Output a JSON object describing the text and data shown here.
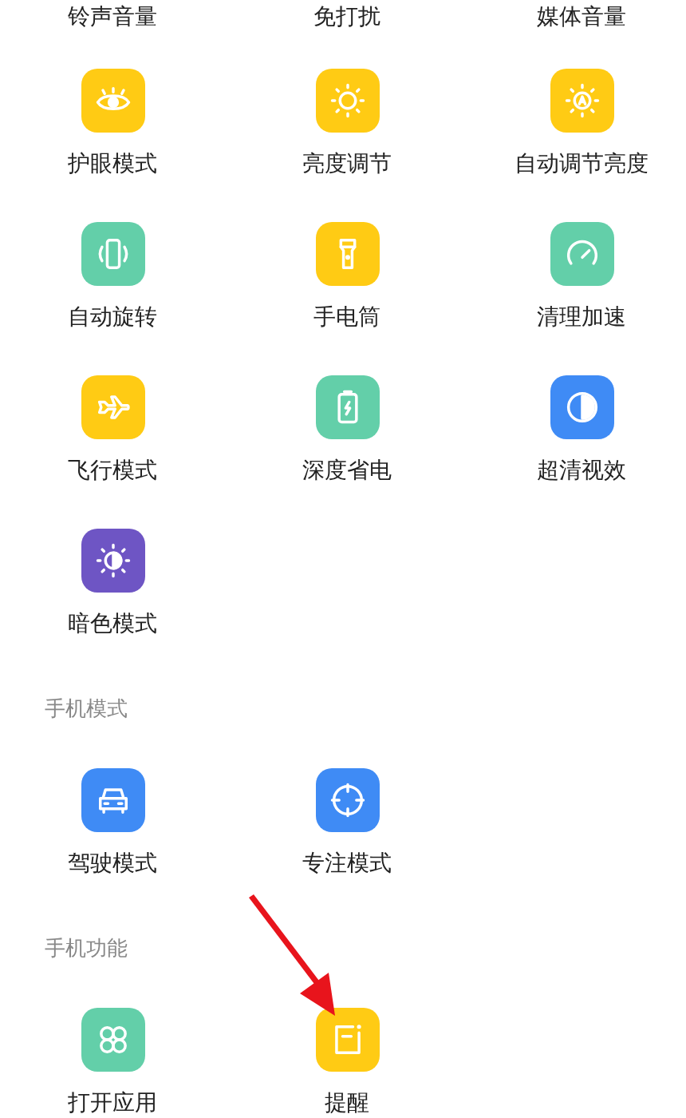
{
  "top_labels": [
    "铃声音量",
    "免打扰",
    "媒体音量"
  ],
  "sections": [
    {
      "items": [
        {
          "label": "护眼模式",
          "kind": "eye",
          "color": "#ffcb14"
        },
        {
          "label": "亮度调节",
          "kind": "sun",
          "color": "#ffcb14"
        },
        {
          "label": "自动调节亮度",
          "kind": "sun-auto",
          "color": "#ffcb14"
        },
        {
          "label": "自动旋转",
          "kind": "rotate",
          "color": "#63cfa9"
        },
        {
          "label": "手电筒",
          "kind": "flashlight",
          "color": "#ffcb14"
        },
        {
          "label": "清理加速",
          "kind": "gauge",
          "color": "#63cfa9"
        },
        {
          "label": "飞行模式",
          "kind": "plane",
          "color": "#ffcb14"
        },
        {
          "label": "深度省电",
          "kind": "battery",
          "color": "#63cfa9"
        },
        {
          "label": "超清视效",
          "kind": "contrast",
          "color": "#3f8bf5"
        },
        {
          "label": "暗色模式",
          "kind": "dark",
          "color": "#6e55c4"
        }
      ]
    },
    {
      "title": "手机模式",
      "items": [
        {
          "label": "驾驶模式",
          "kind": "car",
          "color": "#3f8bf5"
        },
        {
          "label": "专注模式",
          "kind": "target",
          "color": "#3f8bf5"
        }
      ]
    },
    {
      "title": "手机功能",
      "items": [
        {
          "label": "打开应用",
          "kind": "apps",
          "color": "#63cfa9"
        },
        {
          "label": "提醒",
          "kind": "note",
          "color": "#ffcb14"
        }
      ]
    }
  ]
}
